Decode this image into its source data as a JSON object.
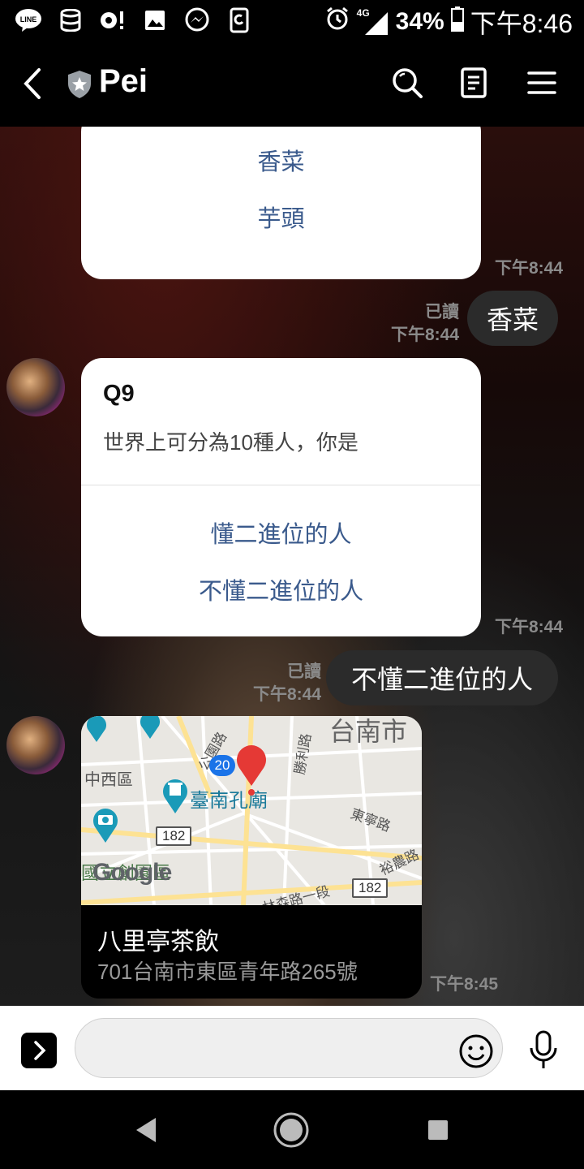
{
  "status_bar": {
    "network": "4G",
    "battery": "34%",
    "time": "下午8:46",
    "line_icon_text": "LINE"
  },
  "header": {
    "title": "Pei"
  },
  "messages": {
    "card1": {
      "options": [
        "香菜",
        "芋頭"
      ],
      "time": "下午8:44"
    },
    "reply1": {
      "text": "香菜",
      "read": "已讀",
      "time": "下午8:44"
    },
    "card2": {
      "question_title": "Q9",
      "question_text": "世界上可分為10種人，你是",
      "options": [
        "懂二進位的人",
        "不懂二進位的人"
      ],
      "time": "下午8:44"
    },
    "reply2": {
      "text": "不懂二進位的人",
      "read": "已讀",
      "time": "下午8:44"
    },
    "location": {
      "place_name": "八里亭茶飲",
      "address": "701台南市東區青年路265號",
      "time": "下午8:45",
      "map_labels": {
        "district_west": "中西區",
        "temple": "臺南孔廟",
        "city": "台南市",
        "road_gongyuan": "公園路",
        "road_shengli": "勝利路",
        "road_dongning": "東寧路",
        "road_yunong": "裕農路",
        "road_lin_sen": "林森路一段",
        "cultural_park": "國立創園區",
        "route_20": "20",
        "route_182_a": "182",
        "route_182_b": "182",
        "google": "Google"
      }
    }
  },
  "input": {
    "placeholder": ""
  },
  "colors": {
    "accent_option": "#3a5a8c",
    "pin": "#e53935"
  }
}
